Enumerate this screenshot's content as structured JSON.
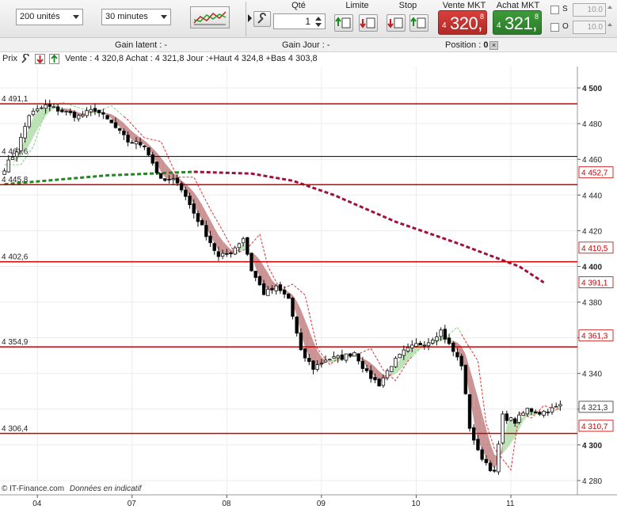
{
  "toolbar": {
    "units_select": "200 unités",
    "interval_select": "30 minutes",
    "qty_label": "Qté",
    "qty_value": "1",
    "limit_label": "Limite",
    "stop_label": "Stop",
    "sell_label": "Vente MKT",
    "buy_label": "Achat MKT",
    "sell_small": "4",
    "sell_big": "320,",
    "sell_tiny": "8",
    "buy_small": "4",
    "buy_big": "321,",
    "buy_tiny": "8",
    "s_label": "S",
    "o_label": "O",
    "s_value": "10.0",
    "o_value": "10.0",
    "sell_color": "#d8403c",
    "buy_color": "#3d9b3a"
  },
  "info": {
    "gain_latent_label": "Gain latent :",
    "gain_latent_value": "-",
    "gain_jour_label": "Gain Jour :",
    "gain_jour_value": "-",
    "position_label": "Position :",
    "position_value": "0"
  },
  "legend": {
    "prix_label": "Prix",
    "quote_text": "Vente : 4 320,8 Achat : 4 321,8 Jour :+Haut 4 324,8 +Bas 4 303,8"
  },
  "footer": {
    "copyright": "© IT-Finance.com",
    "disclaimer": "Données en indicatif"
  },
  "chart_data": {
    "type": "candlestick",
    "ylim": [
      4272,
      4512
    ],
    "y_ticks": [
      4280,
      4300,
      4320,
      4340,
      4360,
      4380,
      4400,
      4420,
      4440,
      4460,
      4480,
      4500
    ],
    "y_tick_labels": [
      "4 280",
      "4 300",
      "4 320",
      "4 340",
      "4 360",
      "4 380",
      "4 400",
      "4 420",
      "4 440",
      "4 460",
      "4 480",
      "4 500"
    ],
    "x_tick_labels": [
      "04",
      "07",
      "08",
      "09",
      "10",
      "11"
    ],
    "x_tick_positions": [
      8,
      31,
      54,
      77,
      100,
      123
    ],
    "n_candles": 136,
    "horizontal_levels": [
      {
        "label": "4 491,1",
        "value": 4491.1,
        "color": "#cc0000"
      },
      {
        "label": "4 461,6",
        "value": 4461.6,
        "color": "#000000"
      },
      {
        "label": "4 445,8",
        "value": 4445.8,
        "color": "#cc0000"
      },
      {
        "label": "4 402,6",
        "value": 4402.6,
        "color": "#cc0000"
      },
      {
        "label": "4 354,9",
        "value": 4354.9,
        "color": "#cc0000"
      },
      {
        "label": "4 306,4",
        "value": 4306.4,
        "color": "#cc0000"
      }
    ],
    "right_labels": [
      {
        "label": "4 452,7",
        "value": 4452.7,
        "color": "#cc0000"
      },
      {
        "label": "4 410,5",
        "value": 4410.5,
        "color": "#cc0000"
      },
      {
        "label": "4 391,1",
        "value": 4391.1,
        "color": "#cc0000"
      },
      {
        "label": "4 361,3",
        "value": 4361.3,
        "color": "#cc0000"
      },
      {
        "label": "4 321,3",
        "value": 4321.3,
        "color": "#333333"
      },
      {
        "label": "4 310,7",
        "value": 4310.7,
        "color": "#cc0000"
      }
    ],
    "anchors": [
      [
        0,
        4455
      ],
      [
        3,
        4465
      ],
      [
        6,
        4485
      ],
      [
        10,
        4490
      ],
      [
        14,
        4487
      ],
      [
        18,
        4484
      ],
      [
        22,
        4488
      ],
      [
        26,
        4480
      ],
      [
        30,
        4470
      ],
      [
        34,
        4468
      ],
      [
        38,
        4448
      ],
      [
        42,
        4448
      ],
      [
        46,
        4430
      ],
      [
        49,
        4418
      ],
      [
        52,
        4405
      ],
      [
        55,
        4408
      ],
      [
        58,
        4416
      ],
      [
        60,
        4398
      ],
      [
        63,
        4385
      ],
      [
        66,
        4388
      ],
      [
        69,
        4382
      ],
      [
        72,
        4352
      ],
      [
        75,
        4343
      ],
      [
        78,
        4348
      ],
      [
        82,
        4349
      ],
      [
        85,
        4352
      ],
      [
        88,
        4340
      ],
      [
        91,
        4334
      ],
      [
        94,
        4345
      ],
      [
        97,
        4352
      ],
      [
        100,
        4356
      ],
      [
        103,
        4358
      ],
      [
        106,
        4364
      ],
      [
        108,
        4356
      ],
      [
        111,
        4345
      ],
      [
        113,
        4310
      ],
      [
        115,
        4296
      ],
      [
        117,
        4290
      ],
      [
        119,
        4284
      ],
      [
        121,
        4316
      ],
      [
        124,
        4313
      ],
      [
        127,
        4320
      ],
      [
        130,
        4318
      ],
      [
        133,
        4320
      ],
      [
        135,
        4322
      ]
    ],
    "ma_long": [
      [
        46,
        4453
      ],
      [
        60,
        4452
      ],
      [
        70,
        4448
      ],
      [
        80,
        4440
      ],
      [
        95,
        4425
      ],
      [
        110,
        4413
      ],
      [
        125,
        4400
      ],
      [
        131,
        4391
      ]
    ],
    "ma_long_dashed_start": [
      [
        0,
        4446
      ],
      [
        25,
        4451
      ],
      [
        46,
        4453
      ]
    ],
    "colors": {
      "up_fill": "#ffffff",
      "down_fill": "#000000",
      "cloud_up": "#a8d8a0",
      "cloud_down": "#b87070",
      "ma_long": "#a0103a",
      "ma_start": "#1f8a1f",
      "ma_short": "#e03030"
    }
  }
}
